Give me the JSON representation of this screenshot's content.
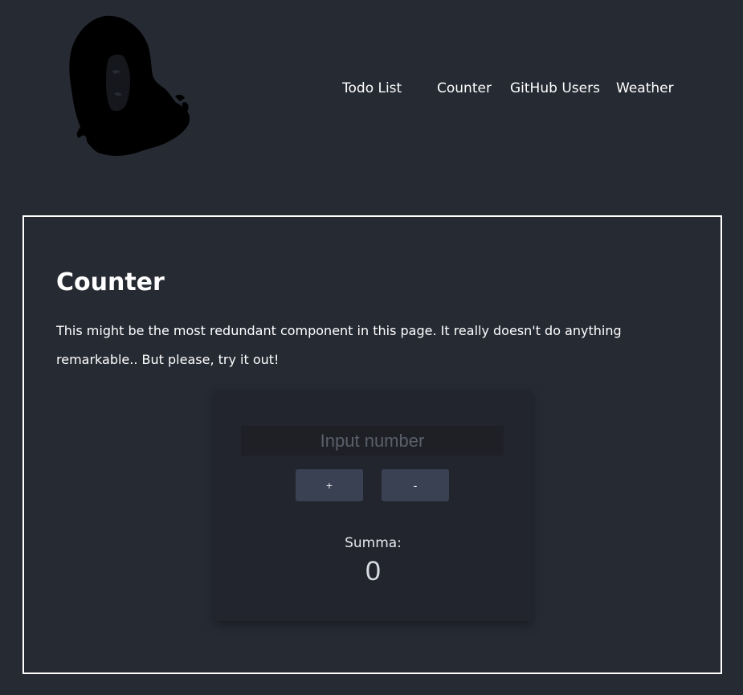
{
  "header": {
    "logo_icon": "portrait-silhouette-logo",
    "nav": [
      {
        "label": "Todo List"
      },
      {
        "label": "Counter"
      },
      {
        "label": "GitHub Users"
      },
      {
        "label": "Weather"
      }
    ]
  },
  "section": {
    "title": "Counter",
    "description": "This might be the most redundant component in this page. It really doesn't do anything remarkable.. But please, try it out!"
  },
  "counter": {
    "input_placeholder": "Input number",
    "input_value": "",
    "plus_label": "+",
    "minus_label": "-",
    "sum_label": "Summa:",
    "sum_value": "0"
  },
  "colors": {
    "background": "#262a33",
    "card": "#22252d",
    "button": "#394152",
    "text": "#ffffff"
  }
}
